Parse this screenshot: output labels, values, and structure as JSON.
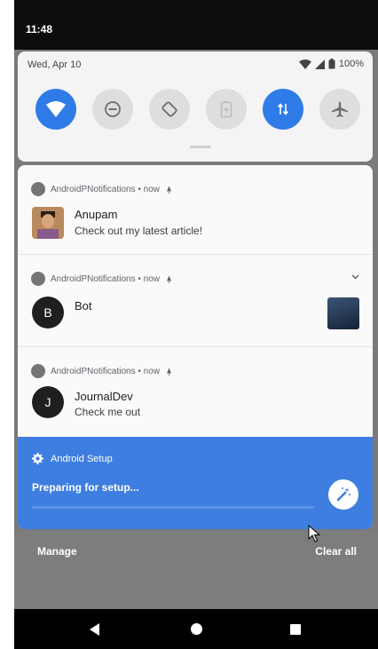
{
  "status_bar": {
    "time": "11:48"
  },
  "quick_settings": {
    "date": "Wed, Apr 10",
    "battery": "100%",
    "tiles": [
      {
        "name": "wifi",
        "state": "on"
      },
      {
        "name": "do-not-disturb",
        "state": "off"
      },
      {
        "name": "auto-rotate",
        "state": "off"
      },
      {
        "name": "battery-saver",
        "state": "off"
      },
      {
        "name": "mobile-data",
        "state": "on"
      },
      {
        "name": "airplane-mode",
        "state": "off"
      }
    ]
  },
  "notifications": [
    {
      "app": "AndroidPNotifications • now",
      "title": "Anupam",
      "text": "Check out my latest article!"
    },
    {
      "app": "AndroidPNotifications • now",
      "title": "Bot",
      "avatar": "B"
    },
    {
      "app": "AndroidPNotifications • now",
      "title": "JournalDev",
      "text": "Check me out",
      "avatar": "J"
    }
  ],
  "setup": {
    "app": "Android Setup",
    "message": "Preparing for setup..."
  },
  "actions": {
    "manage": "Manage",
    "clear_all": "Clear all"
  },
  "colors": {
    "accent": "#2f7be8",
    "setup_bg": "#3d7ee0"
  }
}
